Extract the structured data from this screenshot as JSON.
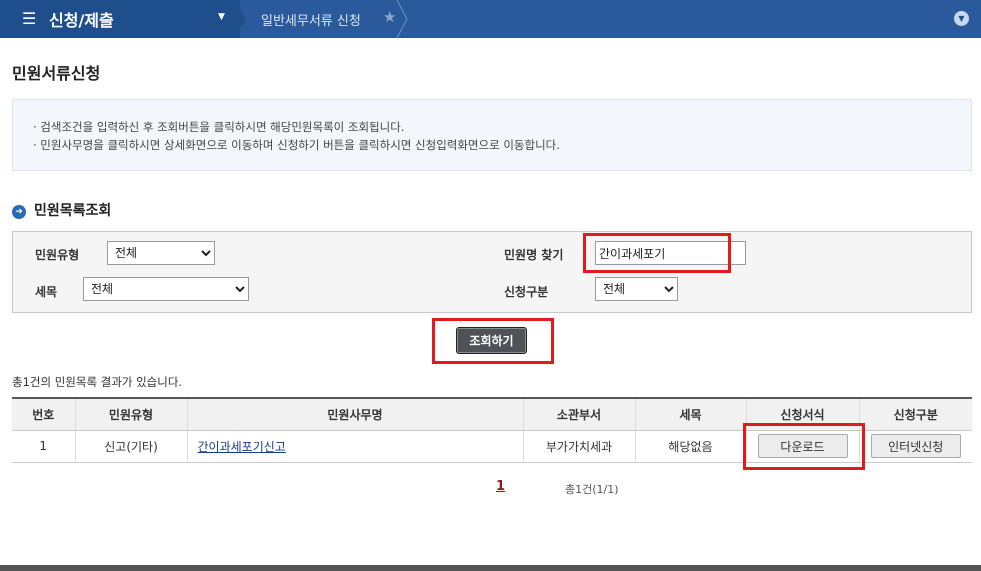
{
  "header": {
    "menu_title": "신청/제출",
    "breadcrumb": "일반세무서류 신청",
    "colors": {
      "bar": "#2a5a9b",
      "menu": "#1f4e8d"
    }
  },
  "page": {
    "title": "민원서류신청"
  },
  "guide": {
    "line1": "· 검색조건을 입력하신 후 조회버튼을 클릭하시면 해당민원목록이 조회됩니다.",
    "line2": "· 민원사무명을 클릭하시면 상세화면으로 이동하며  신청하기 버튼을 클릭하시면 신청입력화면으로 이동합니다."
  },
  "search": {
    "section_title": "민원목록조회",
    "type_label": "민원유형",
    "type_value": "전체",
    "tax_label": "세목",
    "tax_value": "전체",
    "name_label": "민원명 찾기",
    "name_value": "간이과세포기",
    "apply_label": "신청구분",
    "apply_value": "전체",
    "button_label": "조회하기"
  },
  "results": {
    "summary": "총1건의 민원목록 결과가 있습니다.",
    "columns": [
      "번호",
      "민원유형",
      "민원사무명",
      "소관부서",
      "세목",
      "신청서식",
      "신청구분"
    ],
    "rows": [
      {
        "no": "1",
        "type": "신고(기타)",
        "name": "간이과세포기신고",
        "dept": "부가가치세과",
        "tax": "해당없음",
        "form_button": "다운로드",
        "apply_button": "인터넷신청"
      }
    ]
  },
  "pagination": {
    "current": "1",
    "total": "총1건(1/1)"
  },
  "highlight_color": "#e01b1b"
}
